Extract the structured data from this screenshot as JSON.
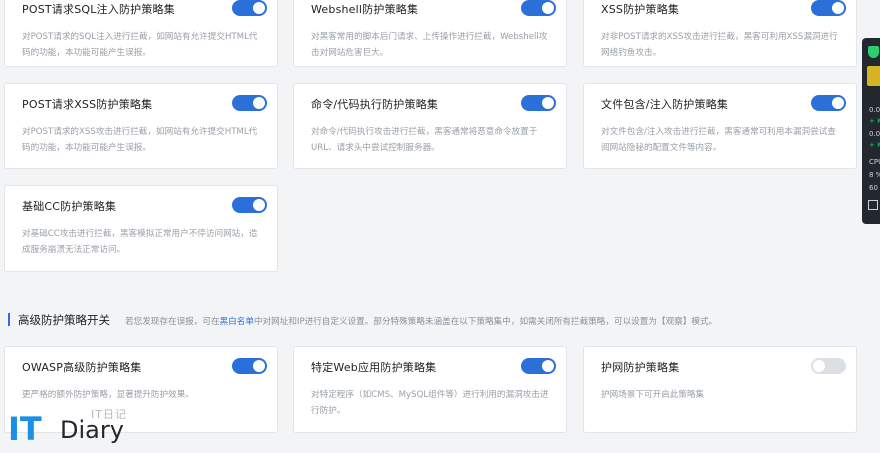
{
  "cards_row0": [
    {
      "title": "POST请求SQL注入防护策略集",
      "desc": "对POST请求的SQL注入进行拦截，如网站有允许提交HTML代码的功能，本功能可能产生误报。",
      "enabled": true
    },
    {
      "title": "Webshell防护策略集",
      "desc": "对黑客常用的脚本后门请求、上传操作进行拦截，Webshell攻击对网站危害巨大。",
      "enabled": true
    },
    {
      "title": "XSS防护策略集",
      "desc": "对非POST请求的XSS攻击进行拦截，黑客可利用XSS漏洞进行网络钓鱼攻击。",
      "enabled": true
    }
  ],
  "cards_row1": [
    {
      "title": "POST请求XSS防护策略集",
      "desc": "对POST请求的XSS攻击进行拦截，如网站有允许提交HTML代码的功能，本功能可能产生误报。",
      "enabled": true
    },
    {
      "title": "命令/代码执行防护策略集",
      "desc": "对命令/代码执行攻击进行拦截，黑客通常将恶意命令放置于URL、请求头中尝试控制服务器。",
      "enabled": true
    },
    {
      "title": "文件包含/注入防护策略集",
      "desc": "对文件包含/注入攻击进行拦截，黑客通常可利用本漏洞尝试查阅网站隐秘的配置文件等内容。",
      "enabled": true
    }
  ],
  "cards_row2": [
    {
      "title": "基础CC防护策略集",
      "desc": "对基础CC攻击进行拦截，黑客模拟正常用户不停访问网站，造成服务崩溃无法正常访问。",
      "enabled": true
    }
  ],
  "advanced": {
    "title": "高级防护策略开关",
    "note_before": "若您发现存在误报，可在",
    "note_link": "黑白名单",
    "note_after": "中对网址和IP进行自定义设置。部分特殊策略未涵盖在以下策略集中，如需关闭所有拦截策略，可以设置为【观察】模式。",
    "cards": [
      {
        "title": "OWASP高级防护策略集",
        "desc": "更严格的额外防护策略，显著提升防护效果。",
        "enabled": true
      },
      {
        "title": "特定Web应用防护策略集",
        "desc": "对特定程序（如CMS、MySQL组件等）进行利用的漏洞攻击进行防护。",
        "enabled": true
      },
      {
        "title": "护网防护策略集",
        "desc": "护网场景下可开启此策略集",
        "enabled": false
      }
    ]
  },
  "side_panel": {
    "l1": "0.0",
    "l2": "+ K",
    "l3": "0.0",
    "l4": "+ K",
    "cpu_label": "CPU",
    "cpu_value": "8 %",
    "mem_value": "60 °"
  },
  "watermark": {
    "logo": "IT",
    "word": "Diary",
    "cn": "IT日记"
  }
}
